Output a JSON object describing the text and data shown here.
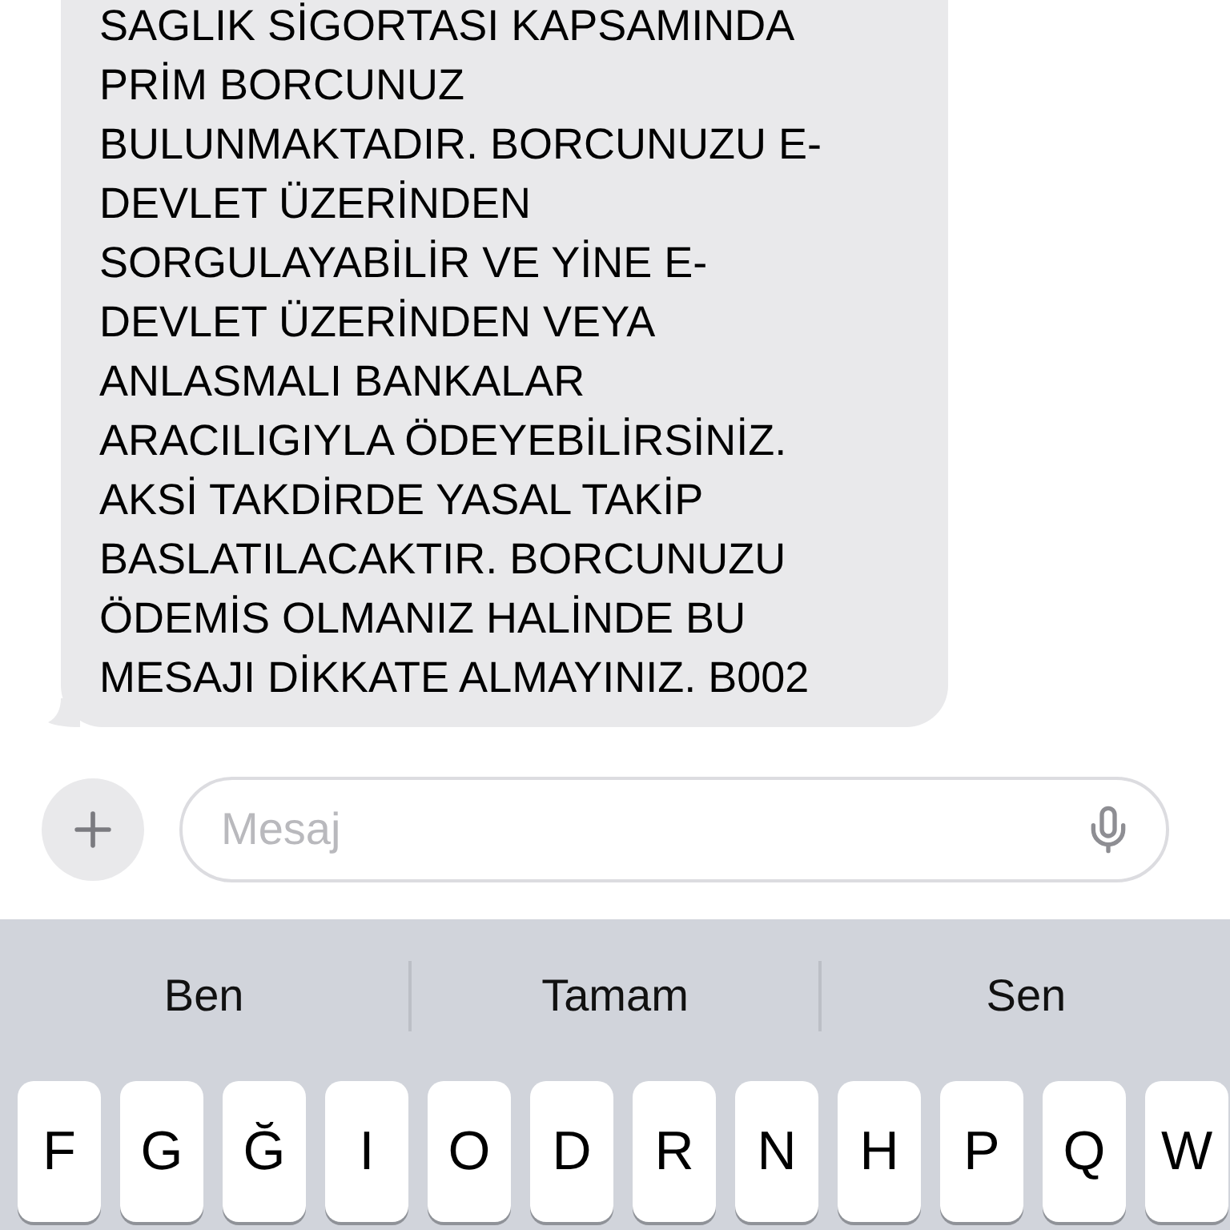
{
  "message": {
    "lines": [
      "SAGLIK SİGORTASI KAPSAMINDA",
      "PRİM BORCUNUZ",
      "BULUNMAKTADIR. BORCUNUZU E-",
      "DEVLET ÜZERİNDEN",
      "SORGULAYABİLİR VE YİNE E-",
      "DEVLET ÜZERİNDEN VEYA",
      "ANLASMALI BANKALAR",
      "ARACILIGIYLA ÖDEYEBİLİRSİNİZ.",
      "AKSİ TAKDİRDE YASAL TAKİP",
      "BASLATILACAKTIR. BORCUNUZU",
      "ÖDEMİS OLMANIZ HALİNDE BU",
      "MESAJI DİKKATE ALMAYINIZ. B002"
    ]
  },
  "composer": {
    "placeholder": "Mesaj"
  },
  "suggestions": [
    "Ben",
    "Tamam",
    "Sen"
  ],
  "keys": [
    "F",
    "G",
    "Ğ",
    "I",
    "O",
    "D",
    "R",
    "N",
    "H",
    "P",
    "Q",
    "W"
  ]
}
